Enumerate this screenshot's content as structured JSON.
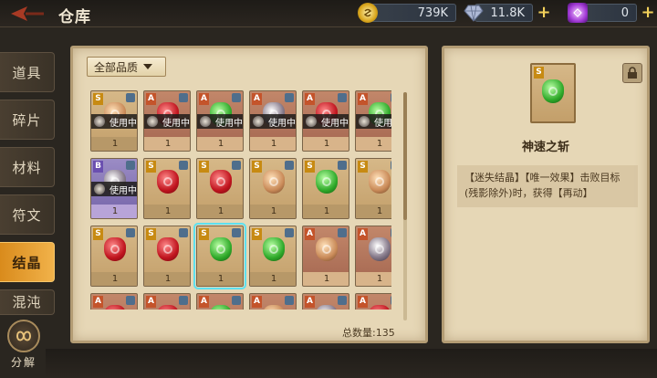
{
  "header": {
    "title": "仓库"
  },
  "currencies": [
    {
      "name": "gold",
      "icon": "gold-coin-icon",
      "value": "739K",
      "has_plus": false
    },
    {
      "name": "diamond",
      "icon": "diamond-icon",
      "value": "11.8K",
      "has_plus": true
    },
    {
      "name": "gem",
      "icon": "purple-gem-icon",
      "value": "0",
      "has_plus": true
    }
  ],
  "sidebar": {
    "items": [
      {
        "label": "道具",
        "active": false
      },
      {
        "label": "碎片",
        "active": false
      },
      {
        "label": "材料",
        "active": false
      },
      {
        "label": "符文",
        "active": false
      },
      {
        "label": "结晶",
        "active": true
      },
      {
        "label": "混沌",
        "active": false
      }
    ],
    "decompose_label": "分解"
  },
  "inventory": {
    "filter_label": "全部品质",
    "total_label": "总数量:135",
    "in_use_label": "使用中",
    "rows": [
      [
        {
          "grade": "S",
          "color": "gold",
          "gem": "tan",
          "in_use": true,
          "qty": "1"
        },
        {
          "grade": "A",
          "color": "orange",
          "gem": "red",
          "in_use": true,
          "qty": "1"
        },
        {
          "grade": "A",
          "color": "orange",
          "gem": "green",
          "in_use": true,
          "qty": "1"
        },
        {
          "grade": "A",
          "color": "orange",
          "gem": "dark",
          "in_use": true,
          "qty": "1"
        },
        {
          "grade": "A",
          "color": "orange",
          "gem": "red",
          "in_use": true,
          "qty": "1"
        },
        {
          "grade": "A",
          "color": "orange",
          "gem": "green",
          "in_use": true,
          "qty": "1"
        }
      ],
      [
        {
          "grade": "B",
          "color": "purple",
          "gem": "dark",
          "in_use": true,
          "qty": "1"
        },
        {
          "grade": "S",
          "color": "gold",
          "gem": "red",
          "in_use": false,
          "qty": "1"
        },
        {
          "grade": "S",
          "color": "gold",
          "gem": "red",
          "in_use": false,
          "qty": "1"
        },
        {
          "grade": "S",
          "color": "gold",
          "gem": "tan",
          "in_use": false,
          "qty": "1"
        },
        {
          "grade": "S",
          "color": "gold",
          "gem": "green",
          "in_use": false,
          "qty": "1"
        },
        {
          "grade": "S",
          "color": "gold",
          "gem": "tan",
          "in_use": false,
          "qty": "1"
        }
      ],
      [
        {
          "grade": "S",
          "color": "gold",
          "gem": "red",
          "in_use": false,
          "qty": "1"
        },
        {
          "grade": "S",
          "color": "gold",
          "gem": "red",
          "in_use": false,
          "qty": "1"
        },
        {
          "grade": "S",
          "color": "gold",
          "gem": "green",
          "in_use": false,
          "qty": "1",
          "selected": true
        },
        {
          "grade": "S",
          "color": "gold",
          "gem": "green",
          "in_use": false,
          "qty": "1"
        },
        {
          "grade": "A",
          "color": "orange",
          "gem": "tan",
          "in_use": false,
          "qty": "1"
        },
        {
          "grade": "A",
          "color": "orange",
          "gem": "dark",
          "in_use": false,
          "qty": "1"
        }
      ],
      [
        {
          "grade": "A",
          "color": "orange",
          "gem": "red",
          "in_use": false,
          "qty": ""
        },
        {
          "grade": "A",
          "color": "orange",
          "gem": "red",
          "in_use": false,
          "qty": ""
        },
        {
          "grade": "A",
          "color": "orange",
          "gem": "green",
          "in_use": false,
          "qty": ""
        },
        {
          "grade": "A",
          "color": "orange",
          "gem": "tan",
          "in_use": false,
          "qty": ""
        },
        {
          "grade": "A",
          "color": "orange",
          "gem": "dark",
          "in_use": false,
          "qty": ""
        },
        {
          "grade": "A",
          "color": "orange",
          "gem": "red",
          "in_use": false,
          "qty": ""
        }
      ]
    ]
  },
  "detail": {
    "grade": "S",
    "name": "神速之斩",
    "description": "【迷失结晶】【唯一效果】击败目标(残影除外)时，获得【再动】"
  },
  "colors": {
    "accent_active_tab": "#f1b24a",
    "selected_outline": "#5de0f0",
    "plus_yellow": "#f2d05a"
  }
}
